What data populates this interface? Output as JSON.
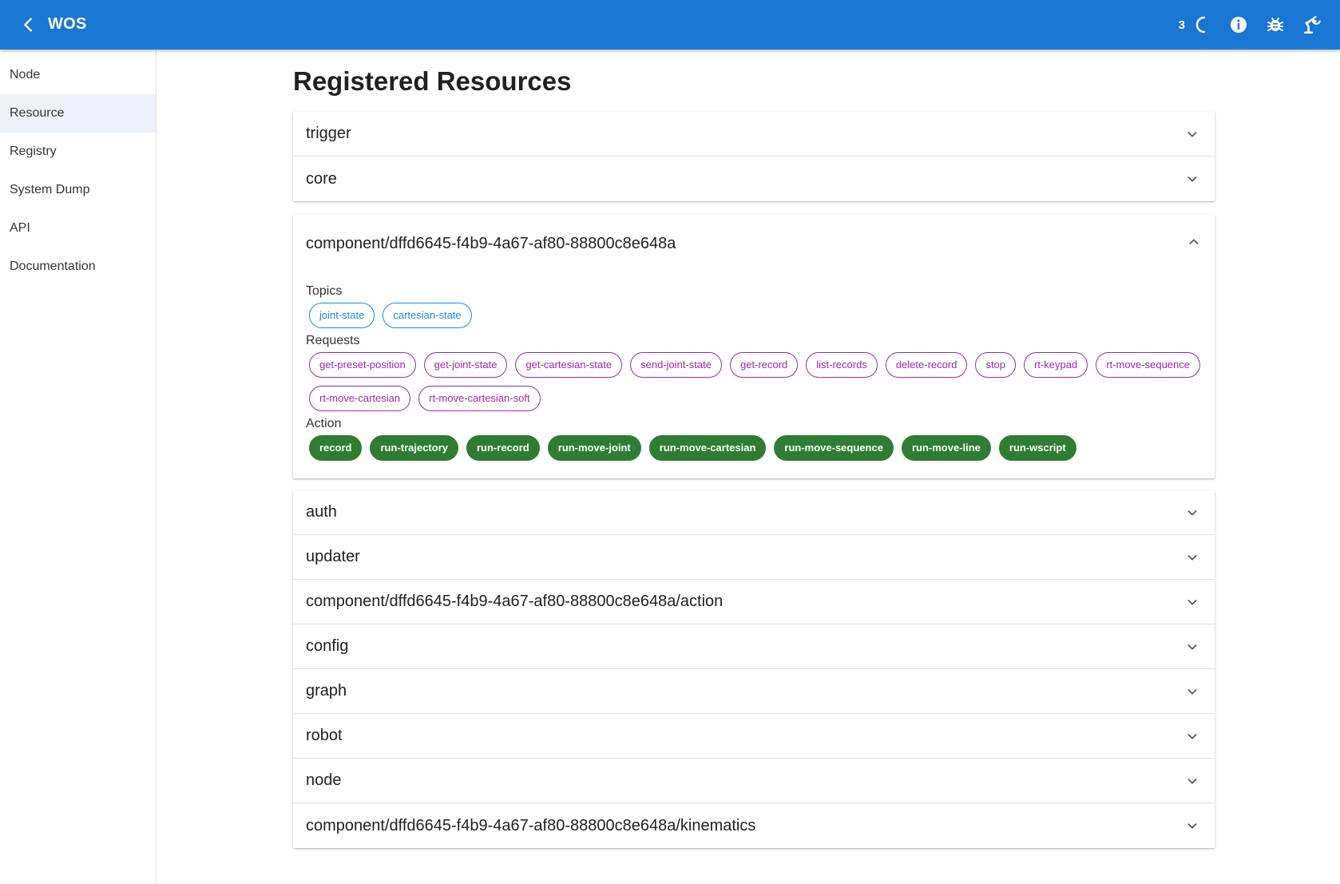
{
  "appbar": {
    "title": "WOS",
    "count": "3",
    "colors": {
      "primary": "#1976d2"
    }
  },
  "sidebar": {
    "items": [
      {
        "label": "Node"
      },
      {
        "label": "Resource",
        "active": true
      },
      {
        "label": "Registry"
      },
      {
        "label": "System Dump"
      },
      {
        "label": "API"
      },
      {
        "label": "Documentation"
      }
    ]
  },
  "page": {
    "title": "Registered Resources"
  },
  "group1": [
    {
      "label": "trigger"
    },
    {
      "label": "core"
    }
  ],
  "expanded": {
    "label": "component/dffd6645-f4b9-4a67-af80-88800c8e648a",
    "topics_label": "Topics",
    "topics": [
      "joint-state",
      "cartesian-state"
    ],
    "requests_label": "Requests",
    "requests": [
      "get-preset-position",
      "get-joint-state",
      "get-cartesian-state",
      "send-joint-state",
      "get-record",
      "list-records",
      "delete-record",
      "stop",
      "rt-keypad",
      "rt-move-sequence",
      "rt-move-cartesian",
      "rt-move-cartesian-soft"
    ],
    "action_label": "Action",
    "actions": [
      "record",
      "run-trajectory",
      "run-record",
      "run-move-joint",
      "run-move-cartesian",
      "run-move-sequence",
      "run-move-line",
      "run-wscript"
    ],
    "colors": {
      "topic": "#1e88e5",
      "request": "#9c27b0",
      "action": "#2e7d32"
    }
  },
  "group3": [
    {
      "label": "auth"
    },
    {
      "label": "updater"
    },
    {
      "label": "component/dffd6645-f4b9-4a67-af80-88800c8e648a/action"
    },
    {
      "label": "config"
    },
    {
      "label": "graph"
    },
    {
      "label": "robot"
    },
    {
      "label": "node"
    },
    {
      "label": "component/dffd6645-f4b9-4a67-af80-88800c8e648a/kinematics"
    }
  ]
}
